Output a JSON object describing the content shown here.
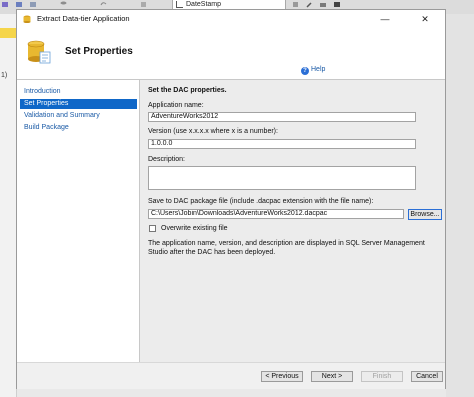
{
  "background": {
    "search_text": "DateStamp",
    "left_marker": "1)"
  },
  "dialog": {
    "title": "Extract Data-tier Application",
    "minimize_glyph": "—",
    "close_glyph": "✕",
    "header_title": "Set Properties",
    "help_label": "Help",
    "nav_items": [
      {
        "label": "Introduction"
      },
      {
        "label": "Set Properties"
      },
      {
        "label": "Validation and Summary"
      },
      {
        "label": "Build Package"
      }
    ],
    "section_heading": "Set the DAC properties.",
    "app_name_label": "Application name:",
    "app_name_value": "AdventureWorks2012",
    "version_label": "Version (use x.x.x.x where x is a number):",
    "version_value": "1.0.0.0",
    "description_label": "Description:",
    "description_value": "",
    "save_label": "Save to DAC package file (include .dacpac extension with the file name):",
    "save_value": "C:\\Users\\Jobin\\Downloads\\AdventureWorks2012.dacpac",
    "browse_label": "Browse...",
    "overwrite_label": "Overwrite existing file",
    "overwrite_checked": false,
    "info_text": "The application name, version, and description are displayed in SQL Server Management Studio after the DAC has been deployed.",
    "buttons": {
      "previous": "< Previous",
      "next": "Next >",
      "finish": "Finish",
      "cancel": "Cancel"
    }
  },
  "colors": {
    "accent": "#0f67c8",
    "link": "#1a5aa6"
  }
}
